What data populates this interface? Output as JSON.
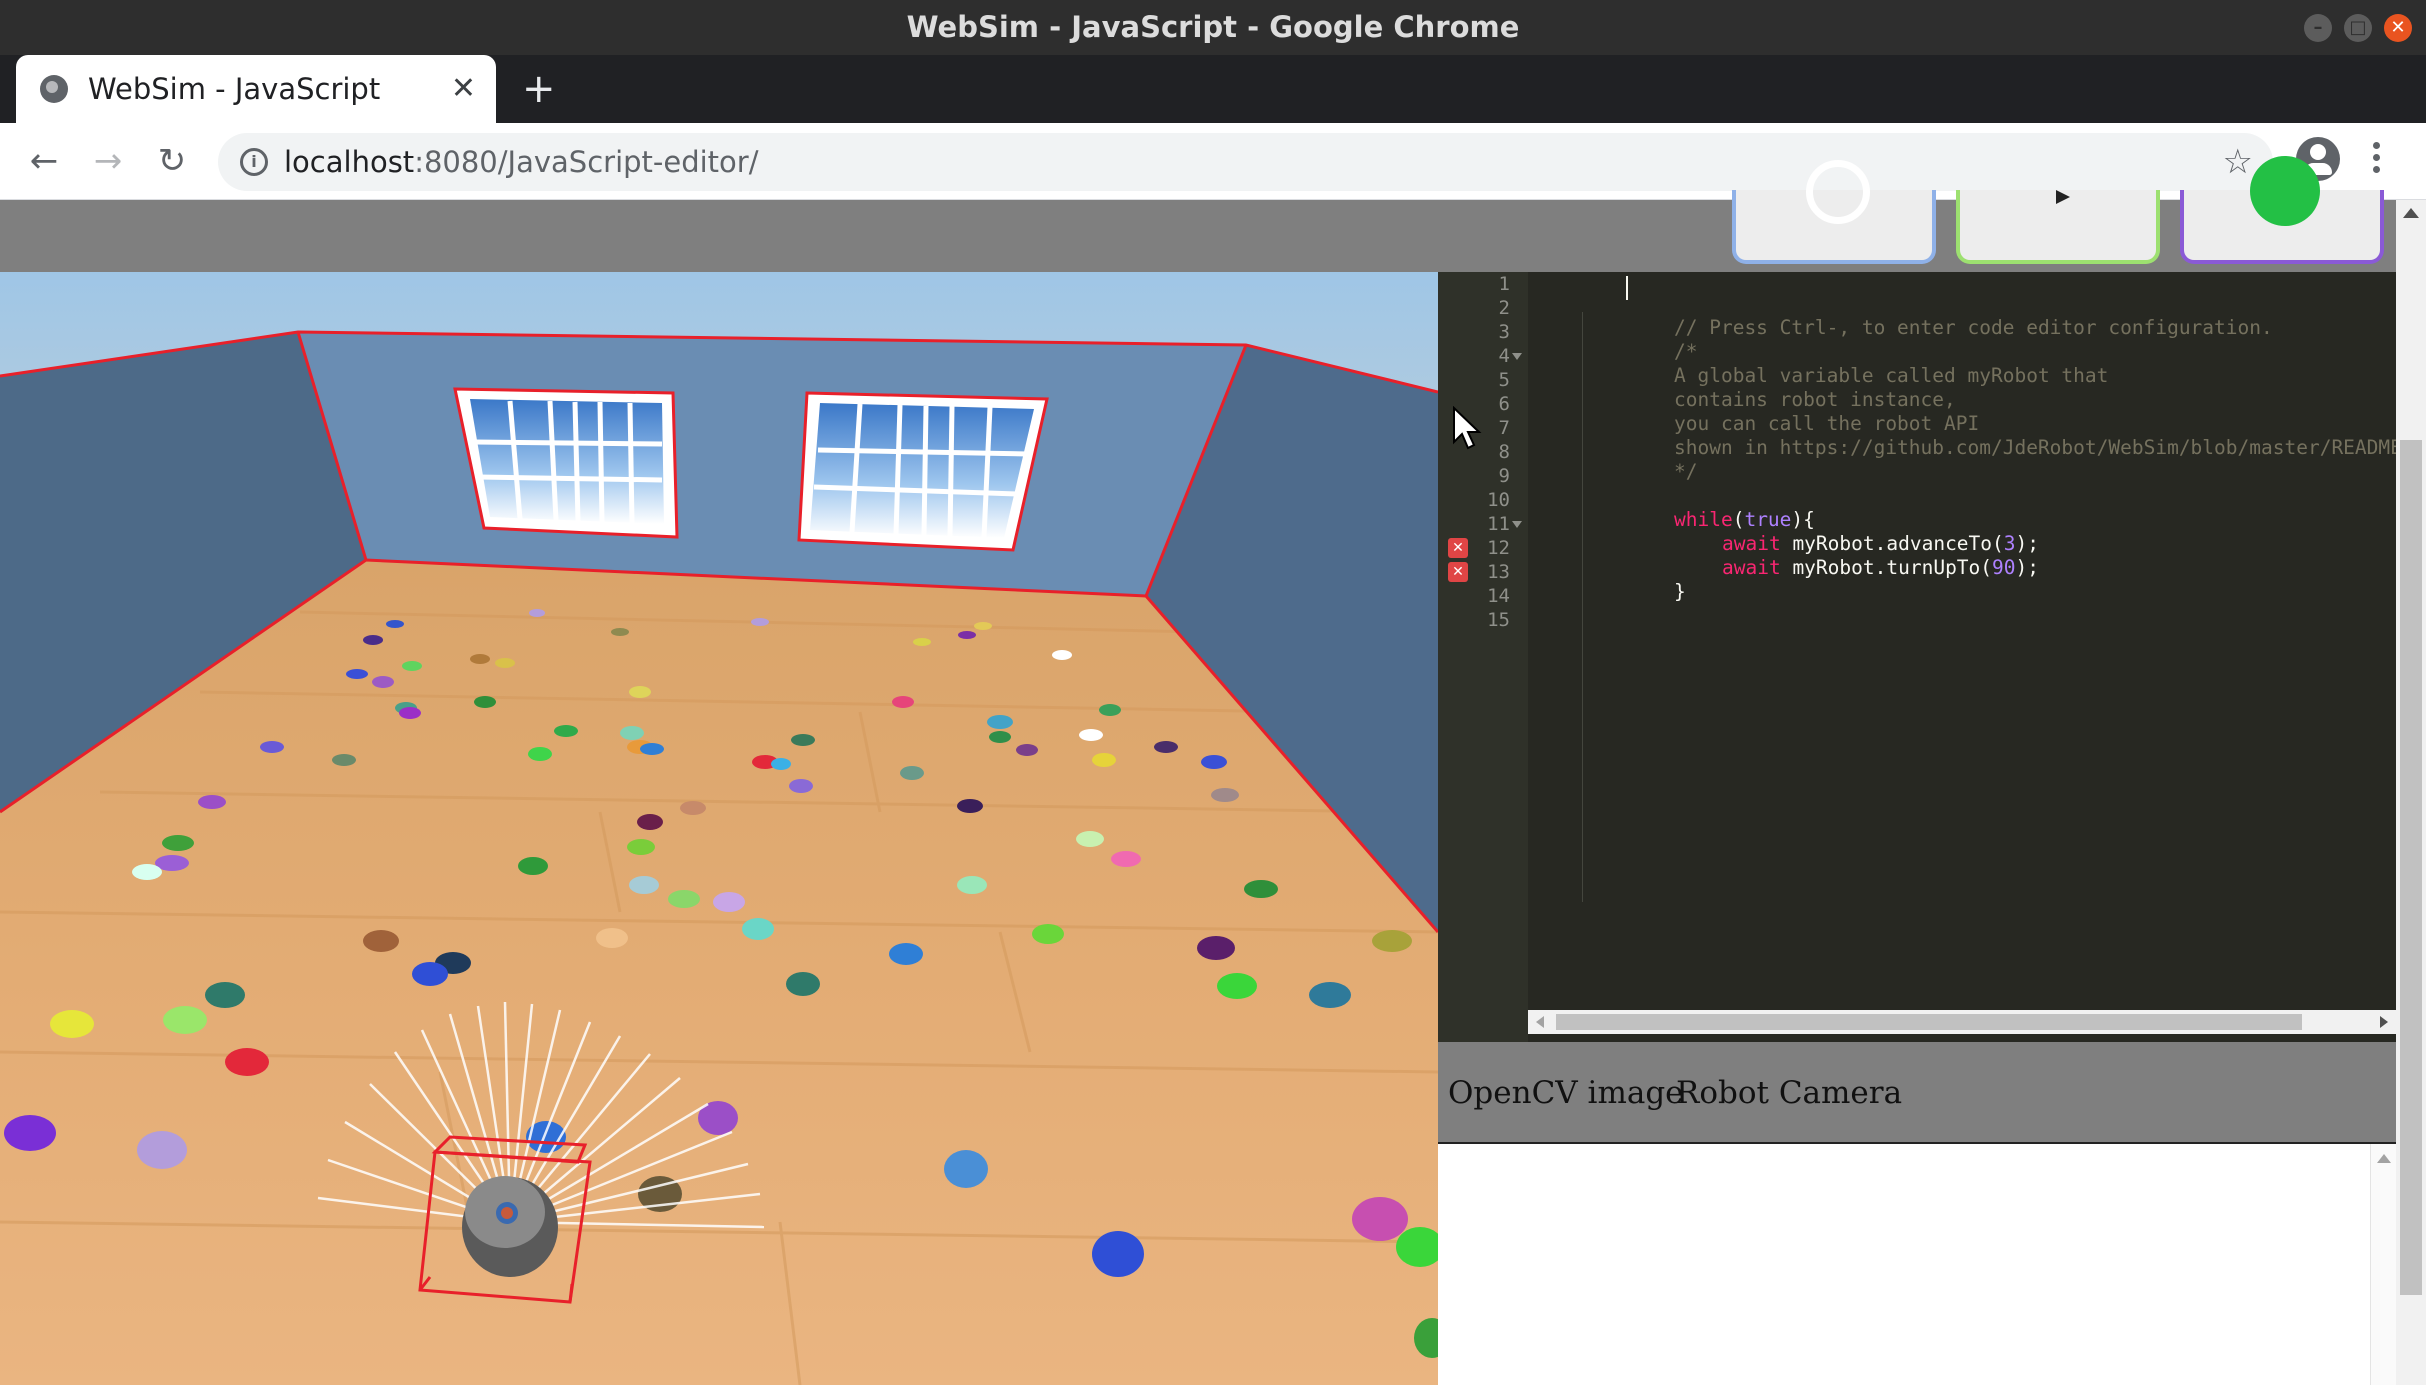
{
  "window": {
    "title": "WebSim - JavaScript - Google Chrome"
  },
  "browser": {
    "tab_title": "WebSim - JavaScript",
    "tab_close": "✕",
    "new_tab": "+",
    "url_host": "localhost",
    "url_path": ":8080/JavaScript-editor/",
    "back": "←",
    "forward": "→",
    "reload": "↻",
    "star": "☆",
    "info": "i"
  },
  "controls": {
    "reset_icon": "reset-icon",
    "play_icon": "play-icon",
    "go_icon": "go-icon",
    "colors": {
      "blue": "#8fb1e8",
      "green": "#9de070",
      "purple": "#8a5ad6"
    }
  },
  "editor": {
    "line_numbers": [
      "1",
      "2",
      "3",
      "4",
      "5",
      "6",
      "7",
      "8",
      "9",
      "10",
      "11",
      "12",
      "13",
      "14",
      "15"
    ],
    "error_lines": [
      12,
      13
    ],
    "fold_lines": [
      4,
      11
    ],
    "lines": {
      "l3": "// Press Ctrl-, to enter code editor configuration.",
      "l4": "/*",
      "l5": "A global variable called myRobot that",
      "l6": "contains robot instance,",
      "l7": "you can call the robot API",
      "l8": "shown in https://github.com/JdeRobot/WebSim/blob/master/README",
      "l9": "*/",
      "l11_kw": "while",
      "l11_open": "(",
      "l11_lit": "true",
      "l11_close": "){",
      "l12_kw": "await",
      "l12_call": " myRobot.advanceTo(",
      "l12_num": "3",
      "l12_end": ");",
      "l13_kw": "await",
      "l13_call": " myRobot.turnUpTo(",
      "l13_num": "90",
      "l13_end": ");",
      "l14": "}"
    },
    "error_icon": "✕"
  },
  "view_tabs": {
    "opencv": "OpenCV image",
    "camera": "Robot Camera"
  }
}
